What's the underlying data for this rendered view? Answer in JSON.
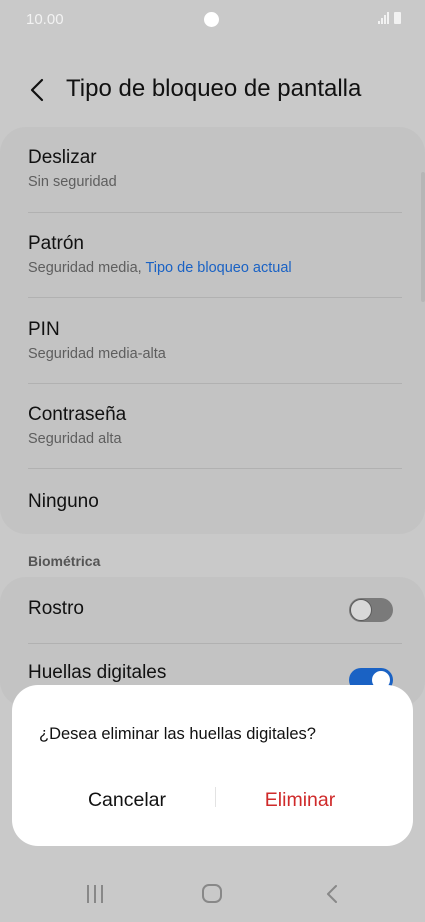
{
  "status_bar": {
    "time": "10.00"
  },
  "header": {
    "title": "Tipo de bloqueo de pantalla"
  },
  "lock_options": [
    {
      "title": "Deslizar",
      "subtitle": "Sin seguridad"
    },
    {
      "title": "Patrón",
      "subtitle": "Seguridad media, ",
      "subtitle_link": "Tipo de bloqueo actual"
    },
    {
      "title": "PIN",
      "subtitle": "Seguridad media-alta"
    },
    {
      "title": "Contraseña",
      "subtitle": "Seguridad alta"
    },
    {
      "title": "Ninguno"
    }
  ],
  "biometrics": {
    "section_label": "Biométrica",
    "items": [
      {
        "title": "Rostro",
        "enabled": false
      },
      {
        "title": "Huellas digitales",
        "enabled": true
      }
    ]
  },
  "dialog": {
    "message": "¿Desea eliminar las huellas digitales?",
    "cancel_label": "Cancelar",
    "confirm_label": "Eliminar"
  },
  "colors": {
    "accent": "#1a62c4",
    "destructive": "#cf2a2a",
    "scrim": "#c9c9c9"
  },
  "icons": [
    "back-arrow-icon",
    "signal-icon",
    "battery-icon",
    "recent-apps-icon",
    "home-icon",
    "nav-back-icon"
  ]
}
